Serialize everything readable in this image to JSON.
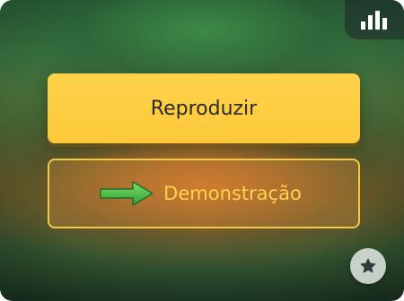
{
  "game_menu": {
    "play_label": "Reproduzir",
    "demo_label": "Demonstração"
  },
  "icons": {
    "stats": "bar-chart-icon",
    "arrow": "right-arrow-icon",
    "favorite": "star-icon"
  },
  "colors": {
    "primary_button": "#fcc83a",
    "secondary_text": "#ffd34d",
    "secondary_border": "#f3c845",
    "arrow": "#4cc04a"
  }
}
